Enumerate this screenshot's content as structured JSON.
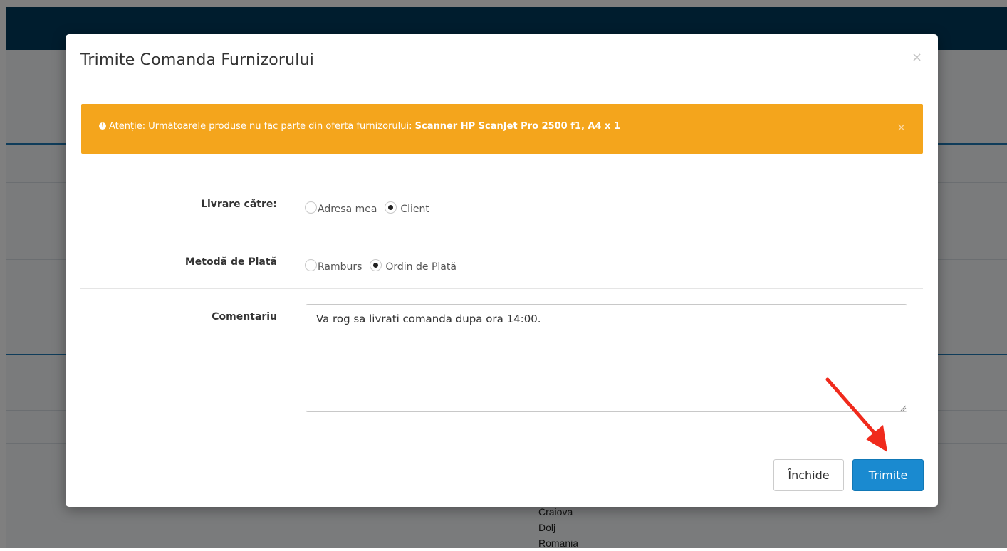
{
  "modal": {
    "title": "Trimite Comanda Furnizorului",
    "close_symbol": "×"
  },
  "alert": {
    "icon": "exclamation-circle-icon",
    "prefix": "Atenție: Următoarele produse nu fac parte din oferta furnizorului:",
    "products": "Scanner HP ScanJet Pro 2500 f1, A4 x 1",
    "close_symbol": "×",
    "color": "#f4a51c"
  },
  "delivery": {
    "label": "Livrare către:",
    "options": [
      "Adresa mea",
      "Client"
    ],
    "selected": "Client"
  },
  "payment": {
    "label": "Metodă de Plată",
    "options": [
      "Ramburs",
      "Ordin de Plată"
    ],
    "selected": "Ordin de Plată"
  },
  "comment": {
    "label": "Comentariu",
    "value": "Va rog sa livrati comanda dupa ora 14:00."
  },
  "buttons": {
    "close_label": "Închide",
    "send_label": "Trimite",
    "send_color": "#1a8ad0"
  },
  "background": {
    "address_lines": [
      "Craiova",
      "Dolj",
      "Romania"
    ],
    "header_color": "#003a5c"
  }
}
